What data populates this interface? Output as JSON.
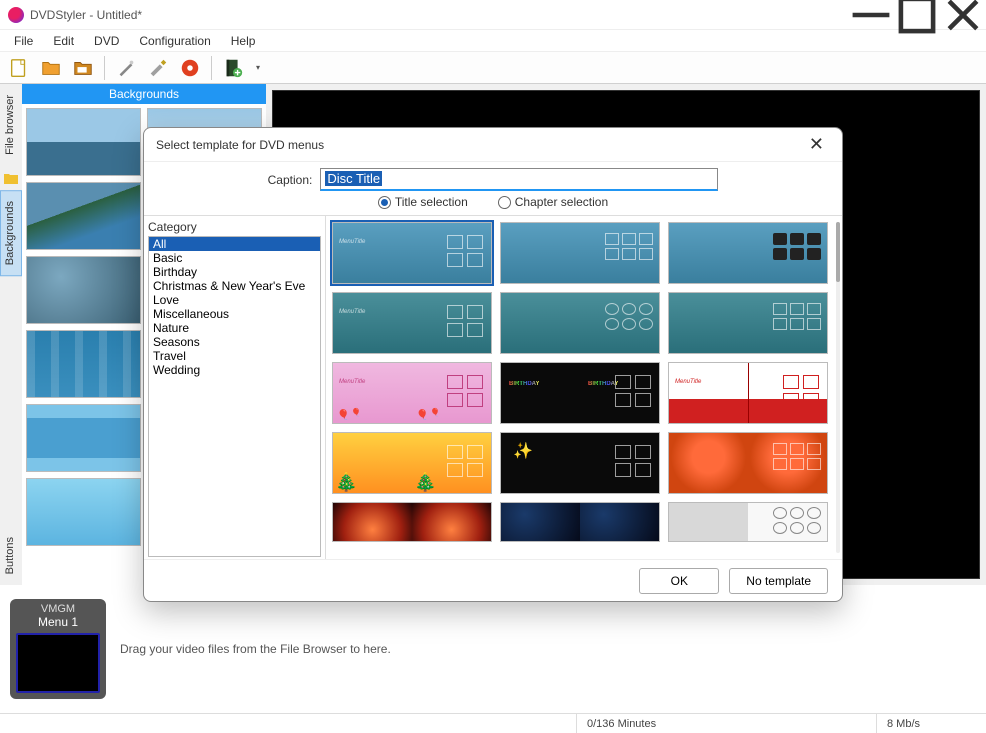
{
  "window": {
    "title": "DVDStyler - Untitled*"
  },
  "menu": {
    "file": "File",
    "edit": "Edit",
    "dvd": "DVD",
    "config": "Configuration",
    "help": "Help"
  },
  "sideTabs": {
    "file": "File browser",
    "backgrounds": "Backgrounds",
    "buttons": "Buttons"
  },
  "panel": {
    "header": "Backgrounds"
  },
  "timeline": {
    "vmgm": "VMGM",
    "menu1": "Menu 1",
    "hint": "Drag your video files from the File Browser to here."
  },
  "status": {
    "time": "0/136 Minutes",
    "bitrate": "8 Mb/s"
  },
  "dialog": {
    "title": "Select template for DVD menus",
    "captionLabel": "Caption:",
    "captionValue": "Disc Title",
    "titleSel": "Title selection",
    "chapterSel": "Chapter selection",
    "categoryLabel": "Category",
    "categories": [
      "All",
      "Basic",
      "Birthday",
      "Christmas & New Year's Eve",
      "Love",
      "Miscellaneous",
      "Nature",
      "Seasons",
      "Travel",
      "Wedding"
    ],
    "ok": "OK",
    "noTemplate": "No template"
  }
}
